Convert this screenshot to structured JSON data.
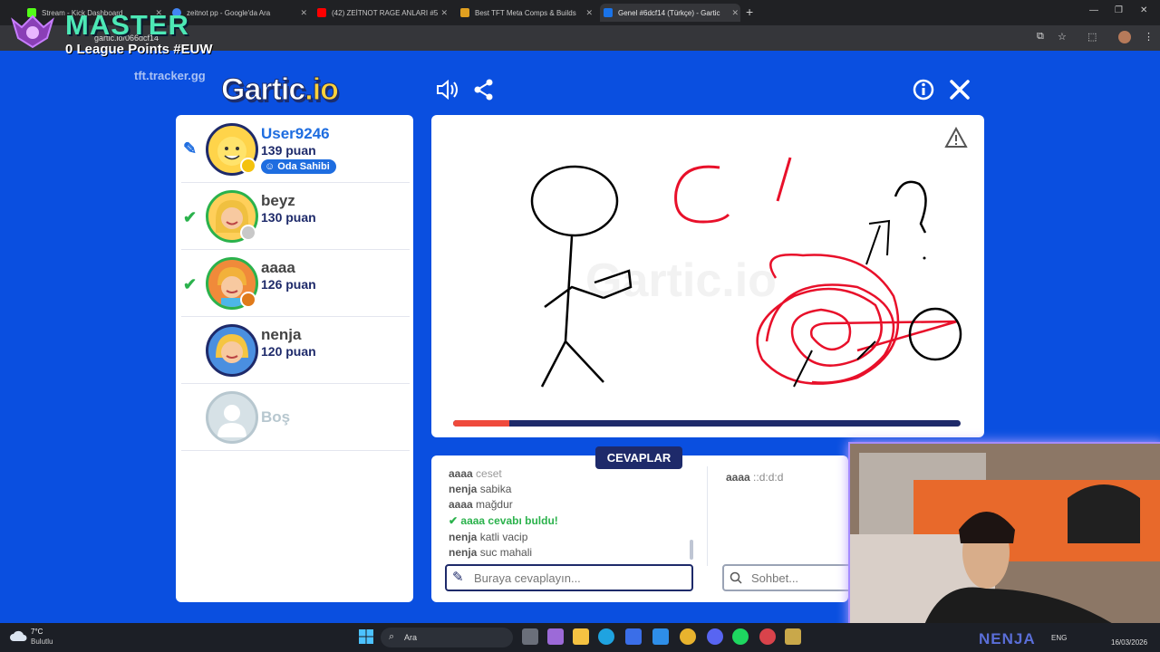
{
  "browser": {
    "tabs": [
      {
        "title": "Stream - Kick Dashboard",
        "color": "#53fc18"
      },
      {
        "title": "zeitnot pp - Google'da Ara",
        "color": "#4285f4"
      },
      {
        "title": "(42) ZEİTNOT RAGE ANLARI #5",
        "color": "#ff0000"
      },
      {
        "title": "Best TFT Meta Comps & Builds",
        "color": "#e0a020"
      },
      {
        "title": "Genel #6dcf14 (Türkçe) - Gartic",
        "color": "#1a73e8"
      }
    ],
    "url": "gartic.io/066dcf14"
  },
  "overlay": {
    "rank": "MASTER",
    "lp": "0 League Points #EUW",
    "tracker": "tft.tracker.gg"
  },
  "game": {
    "logo_main": "Gartic",
    "logo_suffix": ".io",
    "players": [
      {
        "name": "User9246",
        "score": "139 puan",
        "badge": "Oda Sahibi",
        "status": "drawing",
        "dot": "#f4c20d"
      },
      {
        "name": "beyz",
        "score": "130 puan",
        "status": "guessed",
        "dot": "#c8c8c8"
      },
      {
        "name": "aaaa",
        "score": "126 puan",
        "status": "guessed",
        "dot": "#e07a1a"
      },
      {
        "name": "nenja",
        "score": "120 puan",
        "status": "none",
        "dot": ""
      },
      {
        "name": "Boş",
        "score": "",
        "status": "empty",
        "dot": ""
      }
    ],
    "timer_progress": 0.11,
    "answers_title": "CEVAPLAR",
    "answers": [
      {
        "user": "aaaa",
        "text": "ceset"
      },
      {
        "user": "nenja",
        "text": "sabika"
      },
      {
        "user": "aaaa",
        "text": "mağdur"
      },
      {
        "user": "",
        "text": "aaaa cevabı buldu!",
        "correct": true
      },
      {
        "user": "nenja",
        "text": "katli vacip"
      },
      {
        "user": "nenja",
        "text": "suc mahali"
      }
    ],
    "chat": [
      {
        "user": "aaaa",
        "text": "::d:d:d"
      }
    ],
    "answer_placeholder": "Buraya cevaplayın...",
    "chat_placeholder": "Sohbet..."
  },
  "taskbar": {
    "weather_temp": "7°C",
    "weather_desc": "Bulutlu",
    "search": "Ara",
    "lang": "ENG",
    "date": "16/03/2026",
    "stream_name": "NENJA"
  }
}
